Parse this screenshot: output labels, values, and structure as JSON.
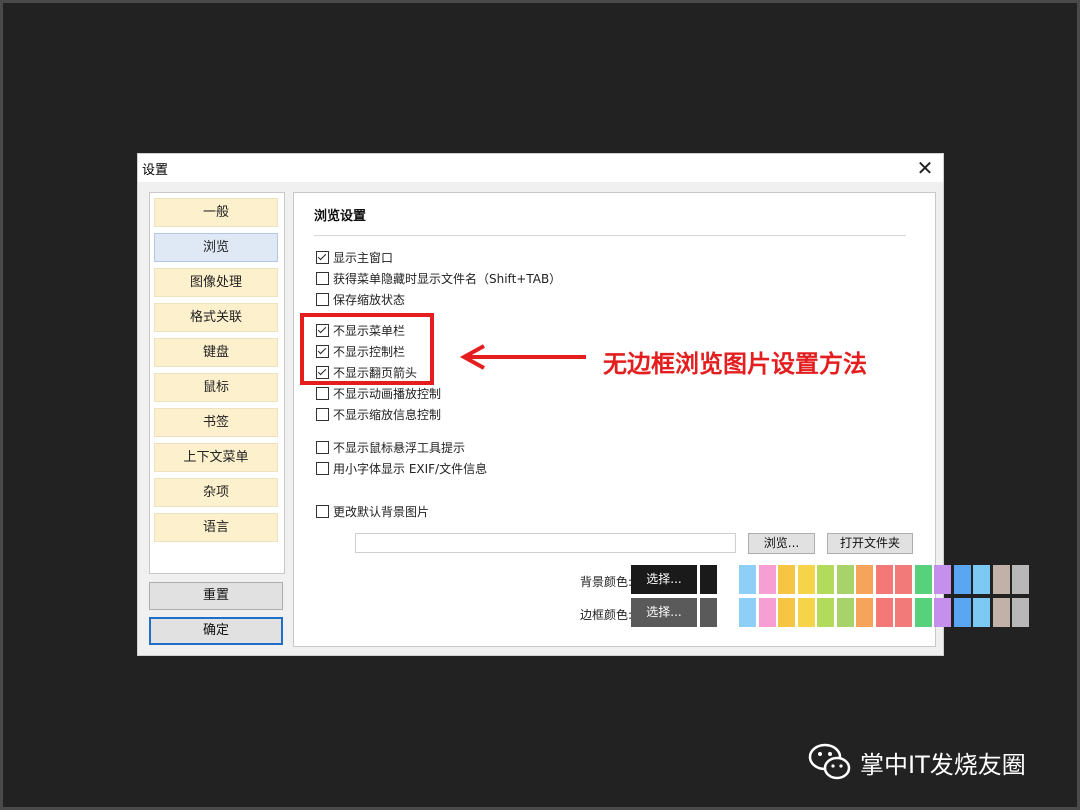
{
  "window": {
    "title": "设置",
    "close_glyph": "✕"
  },
  "sidebar": {
    "items": [
      {
        "label": "一般",
        "active": false
      },
      {
        "label": "浏览",
        "active": true
      },
      {
        "label": "图像处理",
        "active": false
      },
      {
        "label": "格式关联",
        "active": false
      },
      {
        "label": "键盘",
        "active": false
      },
      {
        "label": "鼠标",
        "active": false
      },
      {
        "label": "书签",
        "active": false
      },
      {
        "label": "上下文菜单",
        "active": false
      },
      {
        "label": "杂项",
        "active": false
      },
      {
        "label": "语言",
        "active": false
      }
    ]
  },
  "buttons": {
    "reset_label": "重置",
    "ok_label": "确定",
    "browse_label": "浏览...",
    "open_folder_label": "打开文件夹",
    "choose_label": "选择..."
  },
  "section": {
    "title": "浏览设置"
  },
  "options": [
    {
      "label": "显示主窗口",
      "checked": true
    },
    {
      "label": "获得菜单隐藏时显示文件名（Shift+TAB）",
      "checked": false
    },
    {
      "label": "保存缩放状态",
      "checked": false
    },
    {
      "label": "不显示菜单栏",
      "checked": true
    },
    {
      "label": "不显示控制栏",
      "checked": true
    },
    {
      "label": "不显示翻页箭头",
      "checked": true
    },
    {
      "label": "不显示动画播放控制",
      "checked": false
    },
    {
      "label": "不显示缩放信息控制",
      "checked": false
    },
    {
      "label": "不显示鼠标悬浮工具提示",
      "checked": false
    },
    {
      "label": "用小字体显示 EXIF/文件信息",
      "checked": false
    },
    {
      "label": "更改默认背景图片",
      "checked": false
    }
  ],
  "background_color": {
    "label": "背景颜色:",
    "current": "#1a1a1a"
  },
  "border_color": {
    "label": "边框颜色:",
    "current": "#5a5a5a"
  },
  "palette": [
    "#ffffff",
    "#8ecff7",
    "#f79fd4",
    "#f6c544",
    "#f6d44a",
    "#b3db5b",
    "#a8d26a",
    "#f5a45a",
    "#f47878",
    "#f27a78",
    "#58d17d",
    "#c590ec",
    "#5aa6f2",
    "#7cc9f4",
    "#c2b1a8",
    "#b8b8b8"
  ],
  "annotation": {
    "text": "无边框浏览图片设置方法",
    "color": "#e41e1e"
  },
  "watermark": {
    "text": "掌中IT发烧友圈",
    "icon": "wechat-icon"
  }
}
